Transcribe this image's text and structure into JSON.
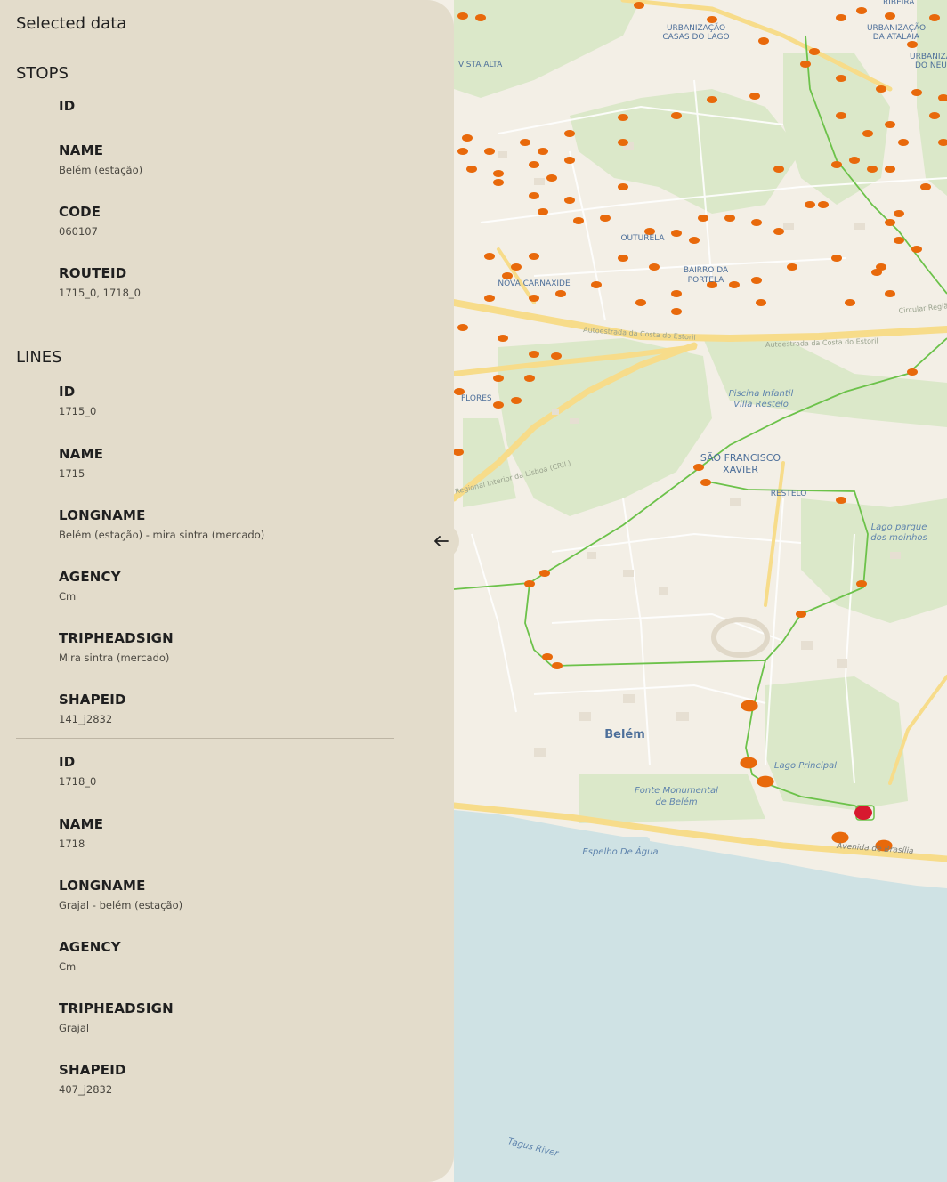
{
  "panel": {
    "title": "Selected data",
    "collapse_icon": "arrow-left-icon",
    "stops": {
      "title": "STOPS",
      "fields": [
        {
          "key": "ID",
          "value": ""
        },
        {
          "key": "NAME",
          "value": "Belém (estação)"
        },
        {
          "key": "CODE",
          "value": "060107"
        },
        {
          "key": "ROUTEID",
          "value": "1715_0, 1718_0"
        }
      ]
    },
    "lines": {
      "title": "LINES",
      "items": [
        {
          "fields": [
            {
              "key": "ID",
              "value": "1715_0"
            },
            {
              "key": "NAME",
              "value": "1715"
            },
            {
              "key": "LONGNAME",
              "value": "Belém (estação) - mira sintra (mercado)"
            },
            {
              "key": "AGENCY",
              "value": "Cm"
            },
            {
              "key": "TRIPHEADSIGN",
              "value": "Mira sintra (mercado)"
            },
            {
              "key": "SHAPEID",
              "value": "141_j2832"
            }
          ]
        },
        {
          "fields": [
            {
              "key": "ID",
              "value": "1718_0"
            },
            {
              "key": "NAME",
              "value": "1718"
            },
            {
              "key": "LONGNAME",
              "value": "Grajal - belém (estação)"
            },
            {
              "key": "AGENCY",
              "value": "Cm"
            },
            {
              "key": "TRIPHEADSIGN",
              "value": "Grajal"
            },
            {
              "key": "SHAPEID",
              "value": "407_j2832"
            }
          ]
        }
      ]
    }
  },
  "map": {
    "colors": {
      "land": "#f3efe6",
      "park": "#dbe8c9",
      "water": "#cfe2e4",
      "road": "#f7dc8a",
      "route": "#6cc24a",
      "stop": "#e8690b",
      "selected_stop": "#d7192f"
    },
    "labels": {
      "ribeira": "RIBEIRA",
      "casas_lago_1": "URBANIZAÇÃO",
      "casas_lago_2": "CASAS DO LAGO",
      "atalaia_1": "URBANIZAÇÃO",
      "atalaia_2": "DA ATALAIA",
      "neu_1": "URBANIZA",
      "neu_2": "DO NEU",
      "vista_alta": "VISTA ALTA",
      "outurela": "OUTURELA",
      "nova_carnaxide": "NOVA CARNAXIDE",
      "portela_1": "BAIRRO DA",
      "portela_2": "PORTELA",
      "autoestrada_1": "Autoestrada da Costa do Estoril",
      "autoestrada_2": "Autoestrada da Costa do Estoril",
      "circular": "Circular Região",
      "piscina_1": "Piscina Infantil",
      "piscina_2": "Villa Restelo",
      "flores": "FLORES",
      "regional": "Regional Interior da Lisboa (CRIL)",
      "sao_francisco_1": "SÃO FRANCISCO",
      "sao_francisco_2": "XAVIER",
      "restelo": "RESTELO",
      "lago_parque_1": "Lago parque",
      "lago_parque_2": "dos moinhos",
      "belem": "Belém",
      "lago_principal": "Lago Principal",
      "fonte_1": "Fonte Monumental",
      "fonte_2": "de Belém",
      "avenida_brasilia": "Avenida de Brasília",
      "espelho": "Espelho De Água",
      "tagus": "Tagus River"
    }
  }
}
